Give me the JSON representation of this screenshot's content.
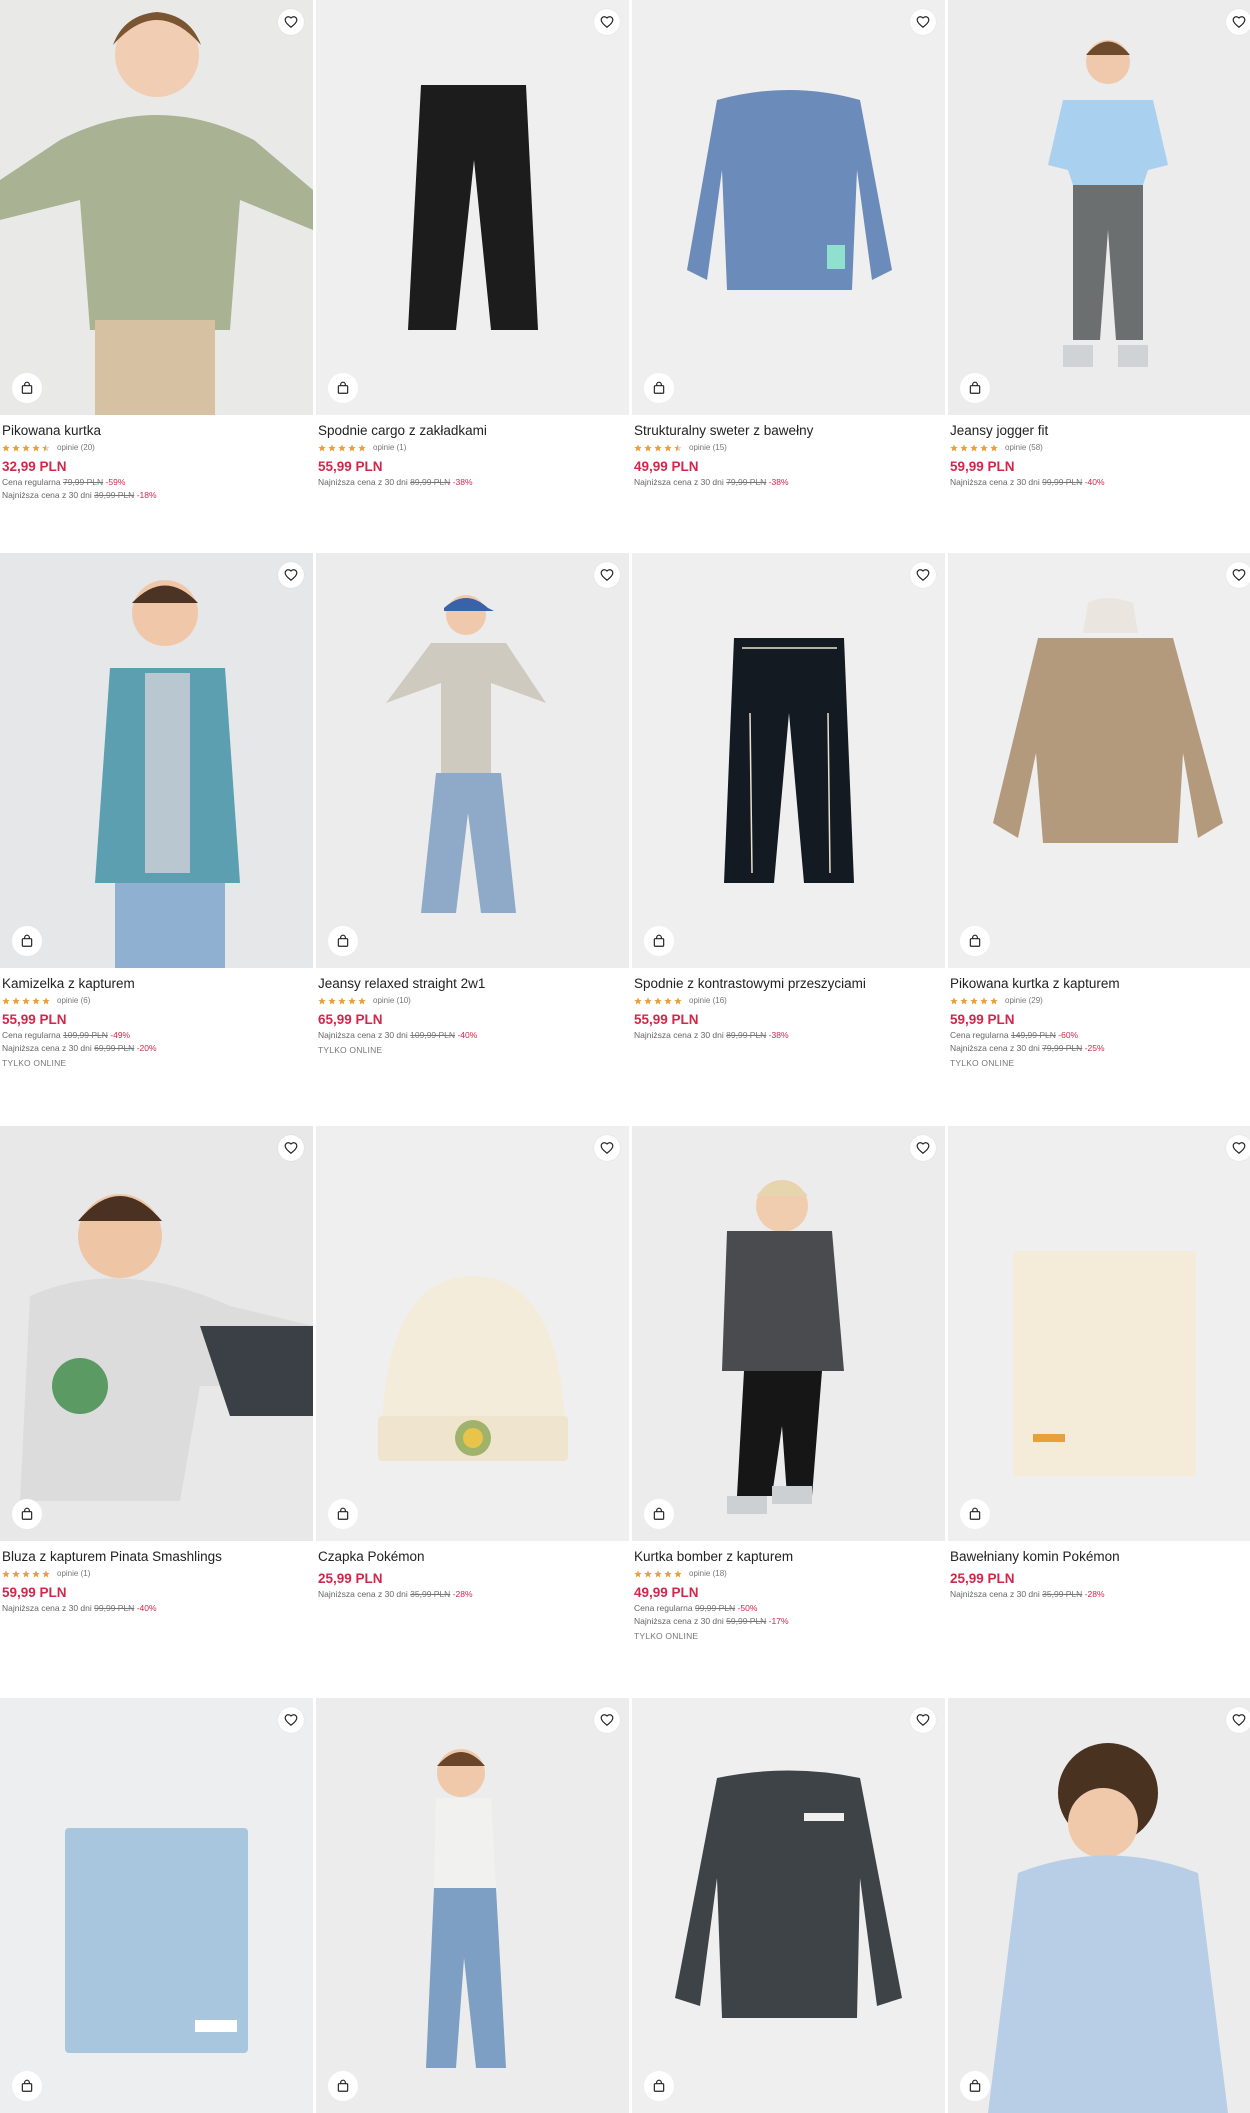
{
  "colors": {
    "price": "#d1274b",
    "star": "#e8a13a",
    "image_bg": "#efefef"
  },
  "icons": {
    "wishlist": "heart-icon",
    "cart": "shopping-bag-icon",
    "rating": "star-icon"
  },
  "products": [
    {
      "name": "Pikowana kurtka",
      "rating": 4.5,
      "reviews": "opinie (20)",
      "price": "32,99 PLN",
      "regular": {
        "label": "Cena regularna",
        "old": "79,99 PLN",
        "disc": "-59%"
      },
      "lowest": {
        "label": "Najniższa cena z 30 dni",
        "old": "39,99 PLN",
        "disc": "-18%"
      },
      "online": ""
    },
    {
      "name": "Spodnie cargo z zakładkami",
      "rating": 5,
      "reviews": "opinie (1)",
      "price": "55,99 PLN",
      "regular": null,
      "lowest": {
        "label": "Najniższa cena z 30 dni",
        "old": "89,99 PLN",
        "disc": "-38%"
      },
      "online": ""
    },
    {
      "name": "Strukturalny sweter z bawełny",
      "rating": 4.5,
      "reviews": "opinie (15)",
      "price": "49,99 PLN",
      "regular": null,
      "lowest": {
        "label": "Najniższa cena z 30 dni",
        "old": "79,99 PLN",
        "disc": "-38%"
      },
      "online": ""
    },
    {
      "name": "Jeansy jogger fit",
      "rating": 5,
      "reviews": "opinie (58)",
      "price": "59,99 PLN",
      "regular": null,
      "lowest": {
        "label": "Najniższa cena z 30 dni",
        "old": "99,99 PLN",
        "disc": "-40%"
      },
      "online": ""
    },
    {
      "name": "Kamizelka z kapturem",
      "rating": 5,
      "reviews": "opinie (6)",
      "price": "55,99 PLN",
      "regular": {
        "label": "Cena regularna",
        "old": "109,99 PLN",
        "disc": "-49%"
      },
      "lowest": {
        "label": "Najniższa cena z 30 dni",
        "old": "69,99 PLN",
        "disc": "-20%"
      },
      "online": "TYLKO ONLINE"
    },
    {
      "name": "Jeansy relaxed straight 2w1",
      "rating": 5,
      "reviews": "opinie (10)",
      "price": "65,99 PLN",
      "regular": null,
      "lowest": {
        "label": "Najniższa cena z 30 dni",
        "old": "109,99 PLN",
        "disc": "-40%"
      },
      "online": "TYLKO ONLINE"
    },
    {
      "name": "Spodnie z kontrastowymi przeszyciami",
      "rating": 5,
      "reviews": "opinie (16)",
      "price": "55,99 PLN",
      "regular": null,
      "lowest": {
        "label": "Najniższa cena z 30 dni",
        "old": "89,99 PLN",
        "disc": "-38%"
      },
      "online": ""
    },
    {
      "name": "Pikowana kurtka z kapturem",
      "rating": 5,
      "reviews": "opinie (29)",
      "price": "59,99 PLN",
      "regular": {
        "label": "Cena regularna",
        "old": "149,99 PLN",
        "disc": "-60%"
      },
      "lowest": {
        "label": "Najniższa cena z 30 dni",
        "old": "79,99 PLN",
        "disc": "-25%"
      },
      "online": "TYLKO ONLINE"
    },
    {
      "name": "Bluza z kapturem Pinata Smashlings",
      "rating": 5,
      "reviews": "opinie (1)",
      "price": "59,99 PLN",
      "regular": null,
      "lowest": {
        "label": "Najniższa cena z 30 dni",
        "old": "99,99 PLN",
        "disc": "-40%"
      },
      "online": ""
    },
    {
      "name": "Czapka Pokémon",
      "rating": 0,
      "reviews": "",
      "price": "25,99 PLN",
      "regular": null,
      "lowest": {
        "label": "Najniższa cena z 30 dni",
        "old": "35,99 PLN",
        "disc": "-28%"
      },
      "online": ""
    },
    {
      "name": "Kurtka bomber z kapturem",
      "rating": 5,
      "reviews": "opinie (18)",
      "price": "49,99 PLN",
      "regular": {
        "label": "Cena regularna",
        "old": "99,99 PLN",
        "disc": "-50%"
      },
      "lowest": {
        "label": "Najniższa cena z 30 dni",
        "old": "59,99 PLN",
        "disc": "-17%"
      },
      "online": "TYLKO ONLINE"
    },
    {
      "name": "Bawełniany komin Pokémon",
      "rating": 0,
      "reviews": "",
      "price": "25,99 PLN",
      "regular": null,
      "lowest": {
        "label": "Najniższa cena z 30 dni",
        "old": "35,99 PLN",
        "disc": "-28%"
      },
      "online": ""
    },
    {
      "name": "",
      "rating": 0,
      "reviews": "",
      "price": "",
      "regular": null,
      "lowest": null,
      "online": ""
    },
    {
      "name": "",
      "rating": 0,
      "reviews": "",
      "price": "",
      "regular": null,
      "lowest": null,
      "online": ""
    },
    {
      "name": "",
      "rating": 0,
      "reviews": "",
      "price": "",
      "regular": null,
      "lowest": null,
      "online": ""
    },
    {
      "name": "",
      "rating": 0,
      "reviews": "",
      "price": "",
      "regular": null,
      "lowest": null,
      "online": ""
    }
  ]
}
